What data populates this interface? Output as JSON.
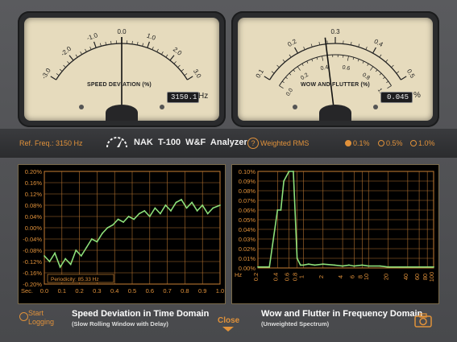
{
  "meters": {
    "speed": {
      "title": "SPEED DEVIATION (%)",
      "scale": [
        "-3.0",
        "-2.0",
        "-1.0",
        "0.0",
        "1.0",
        "2.0",
        "3.0"
      ],
      "readout": "3150.1",
      "unit": "Hz"
    },
    "wf": {
      "title": "WOW AND FLUTTER (%)",
      "scale_outer": [
        "0.1",
        "0.2",
        "0.3",
        "0.4",
        "0.5"
      ],
      "scale_inner": [
        "0.0",
        "0.2",
        "0.4",
        "0.6",
        "0.8",
        "1.0"
      ],
      "readout": "0.045",
      "unit": "%"
    }
  },
  "toolbar": {
    "ref_freq": "Ref. Freq.: 3150 Hz",
    "brand": "NAK  T-100  W&F  Analyzer",
    "help_icon": "?",
    "weighting": "Weighted RMS",
    "ranges": [
      {
        "label": "0.1%",
        "selected": true
      },
      {
        "label": "0.5%",
        "selected": false
      },
      {
        "label": "1.0%",
        "selected": false
      }
    ]
  },
  "time_plot": {
    "yticks": [
      "0.20%",
      "0.16%",
      "0.12%",
      "0.08%",
      "0.04%",
      "0.00%",
      "-0.04%",
      "-0.08%",
      "-0.12%",
      "-0.16%",
      "-0.20%"
    ],
    "xticks": [
      "0.0",
      "0.1",
      "0.2",
      "0.3",
      "0.4",
      "0.5",
      "0.6",
      "0.7",
      "0.8",
      "0.9",
      "1.0"
    ],
    "x_unit": "Sec.",
    "periodicity": "Periodicity:    85.33 Hz"
  },
  "freq_plot": {
    "yticks": [
      "0.10%",
      "0.09%",
      "0.08%",
      "0.07%",
      "0.06%",
      "0.05%",
      "0.04%",
      "0.03%",
      "0.02%",
      "0.01%",
      "0.00%"
    ],
    "xticks": [
      "0.2",
      "0.4",
      "0.6",
      "0.8",
      "1",
      "2",
      "4",
      "6",
      "8",
      "10",
      "20",
      "40",
      "60",
      "80",
      "100"
    ],
    "x_unit": "Hz"
  },
  "footer": {
    "start_logging": "Start\nLogging",
    "time_title": "Speed Deviation in Time Domain",
    "time_sub": "(Slow Rolling Window with Delay)",
    "close": "Close",
    "freq_title": "Wow and Flutter in Frequency Domain",
    "freq_sub": "(Unweighted Spectrum)"
  },
  "chart_data": [
    {
      "type": "line",
      "title": "Speed Deviation in Time Domain",
      "xlabel": "Sec.",
      "ylabel": "",
      "xlim": [
        0,
        1.0
      ],
      "ylim": [
        -0.2,
        0.2
      ],
      "series": [
        {
          "x": [
            0.0,
            0.03,
            0.06,
            0.09,
            0.12,
            0.15,
            0.18,
            0.21,
            0.24,
            0.27,
            0.3,
            0.33,
            0.36,
            0.39,
            0.42,
            0.45,
            0.48,
            0.51,
            0.54,
            0.57,
            0.6,
            0.63,
            0.66,
            0.69,
            0.72,
            0.75,
            0.78,
            0.81,
            0.84,
            0.87,
            0.9,
            0.93,
            0.96,
            1.0
          ],
          "y": [
            -0.1,
            -0.12,
            -0.09,
            -0.14,
            -0.11,
            -0.13,
            -0.08,
            -0.1,
            -0.07,
            -0.04,
            -0.05,
            -0.02,
            0.0,
            0.01,
            0.03,
            0.02,
            0.04,
            0.03,
            0.05,
            0.06,
            0.04,
            0.07,
            0.05,
            0.08,
            0.06,
            0.09,
            0.1,
            0.07,
            0.09,
            0.06,
            0.08,
            0.05,
            0.07,
            0.08
          ]
        }
      ]
    },
    {
      "type": "line",
      "title": "Wow and Flutter in Frequency Domain",
      "xlabel": "Hz",
      "ylabel": "",
      "xlim": [
        0.2,
        100
      ],
      "ylim": [
        0,
        0.1
      ],
      "log_x": true,
      "series": [
        {
          "x": [
            0.2,
            0.3,
            0.4,
            0.45,
            0.5,
            0.6,
            0.7,
            0.8,
            0.9,
            1.0,
            1.2,
            1.5,
            2,
            3,
            4,
            5,
            6,
            8,
            10,
            15,
            20,
            30,
            40,
            60,
            80,
            100
          ],
          "y": [
            0.001,
            0.001,
            0.06,
            0.06,
            0.09,
            0.1,
            0.1,
            0.01,
            0.003,
            0.003,
            0.004,
            0.003,
            0.004,
            0.003,
            0.002,
            0.003,
            0.002,
            0.003,
            0.002,
            0.002,
            0.001,
            0.001,
            0.001,
            0.001,
            0.001,
            0.001
          ]
        }
      ]
    }
  ]
}
